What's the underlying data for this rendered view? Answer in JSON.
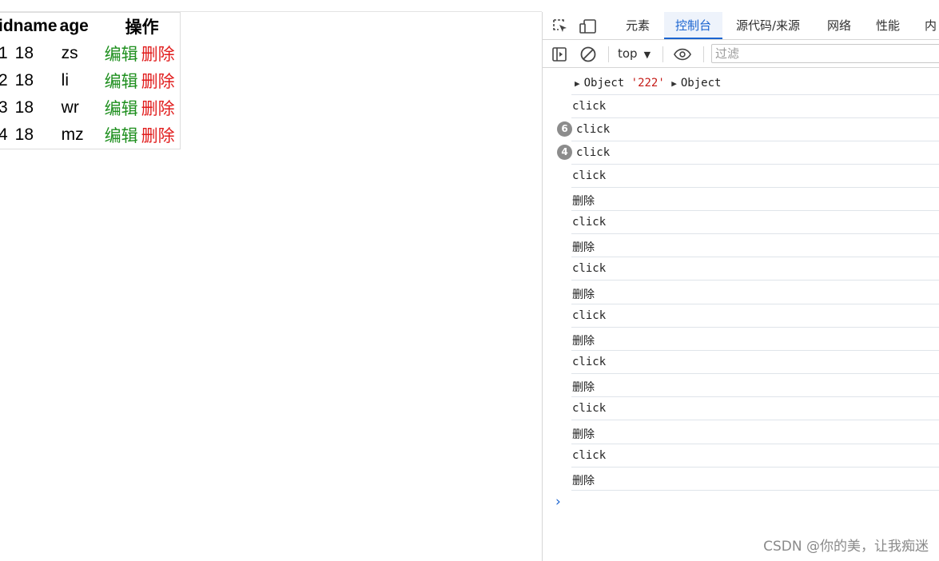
{
  "table": {
    "headers": {
      "id": "id",
      "name": "name",
      "age": "age",
      "actions": "操作"
    },
    "rows": [
      {
        "id": "1",
        "age": "18",
        "name": "zs",
        "edit": "编辑",
        "delete": "删除"
      },
      {
        "id": "2",
        "age": "18",
        "name": "li",
        "edit": "编辑",
        "delete": "删除"
      },
      {
        "id": "3",
        "age": "18",
        "name": "wr",
        "edit": "编辑",
        "delete": "删除"
      },
      {
        "id": "4",
        "age": "18",
        "name": "mz",
        "edit": "编辑",
        "delete": "删除"
      }
    ]
  },
  "devtools": {
    "tabs": [
      "元素",
      "控制台",
      "源代码/来源",
      "网络",
      "性能",
      "内存"
    ],
    "active_tab": "控制台",
    "context": "top",
    "filter_placeholder": "过滤",
    "accent_color": "#1a64d0"
  },
  "console": {
    "first_line": {
      "obj1": "Object",
      "str": "'222'",
      "obj2": "Object"
    },
    "lines": [
      {
        "text": "click"
      },
      {
        "text": "click",
        "count": "6"
      },
      {
        "text": "click",
        "count": "4"
      },
      {
        "text": "click"
      },
      {
        "text": "删除"
      },
      {
        "text": "click"
      },
      {
        "text": "删除"
      },
      {
        "text": "click"
      },
      {
        "text": "删除"
      },
      {
        "text": "click"
      },
      {
        "text": "删除"
      },
      {
        "text": "click"
      },
      {
        "text": "删除"
      },
      {
        "text": "click"
      },
      {
        "text": "删除"
      },
      {
        "text": "click"
      },
      {
        "text": "删除"
      }
    ],
    "prompt": "›"
  },
  "watermark": "CSDN @你的美，让我痴迷"
}
